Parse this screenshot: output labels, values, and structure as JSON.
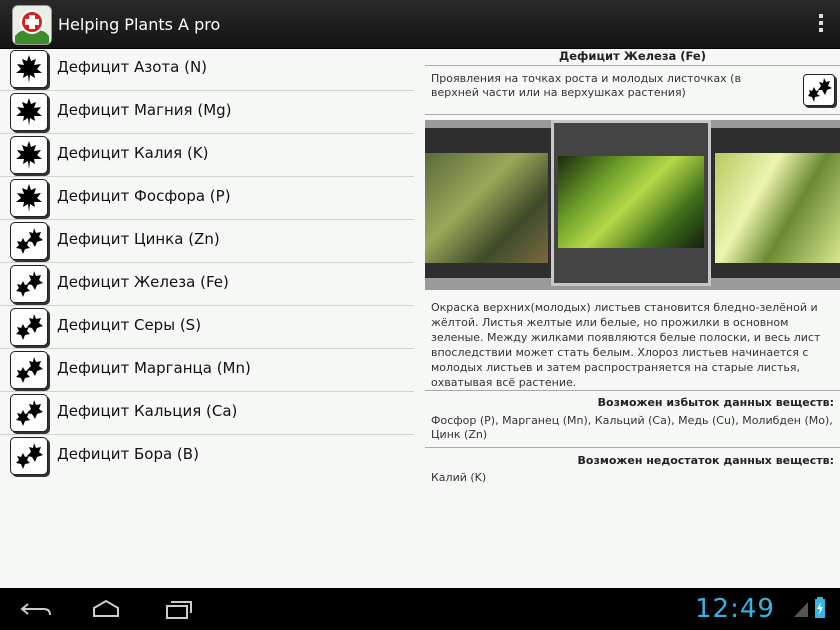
{
  "app": {
    "title": "Helping Plants A pro"
  },
  "list": {
    "items": [
      {
        "label": "Дефицит Азота (N)",
        "icon": "maple-leaf-icon"
      },
      {
        "label": "Дефицит Магния (Mg)",
        "icon": "maple-leaf-icon"
      },
      {
        "label": "Дефицит Калия (K)",
        "icon": "maple-leaf-icon"
      },
      {
        "label": "Дефицит Фосфора (P)",
        "icon": "maple-leaf-icon"
      },
      {
        "label": "Дефицит Цинка (Zn)",
        "icon": "leaf-cluster-icon"
      },
      {
        "label": "Дефицит Железа (Fe)",
        "icon": "leaf-cluster-icon"
      },
      {
        "label": "Дефицит Серы (S)",
        "icon": "leaf-cluster-icon"
      },
      {
        "label": "Дефицит Марганца (Mn)",
        "icon": "leaf-cluster-icon"
      },
      {
        "label": "Дефицит Кальция (Ca)",
        "icon": "leaf-cluster-icon"
      },
      {
        "label": "Дефицит Бора (B)",
        "icon": "leaf-cluster-icon"
      }
    ]
  },
  "detail": {
    "title": "Дефицит Железа (Fe)",
    "manifestation": "Проявления на точках роста и молодых листочках (в верхней части или на верхушках растения)",
    "description": "Окраска верхних(молодых) листьев становится бледно-зелёной и жёлтой. Листья желтые или белые, но прожилки в основном зеленые. Между жилками появляются белые полоски, и весь лист впоследствии может стать белым. Хлороз листьев начинается с молодых листьев и затем распространяется на старые листья, охватывая всё растение.",
    "excess_heading": "Возможен избыток данных веществ:",
    "excess_text": "Фосфор (P), Марганец (Mn), Кальций (Ca), Медь (Cu), Молибден (Mo), Цинк (Zn)",
    "deficit_heading": "Возможен недостаток данных веществ:",
    "deficit_text": "Калий (K)"
  },
  "status": {
    "clock": "12:49"
  },
  "colors": {
    "clock": "#33b5e5",
    "actionbar": "#1e1e1e"
  }
}
